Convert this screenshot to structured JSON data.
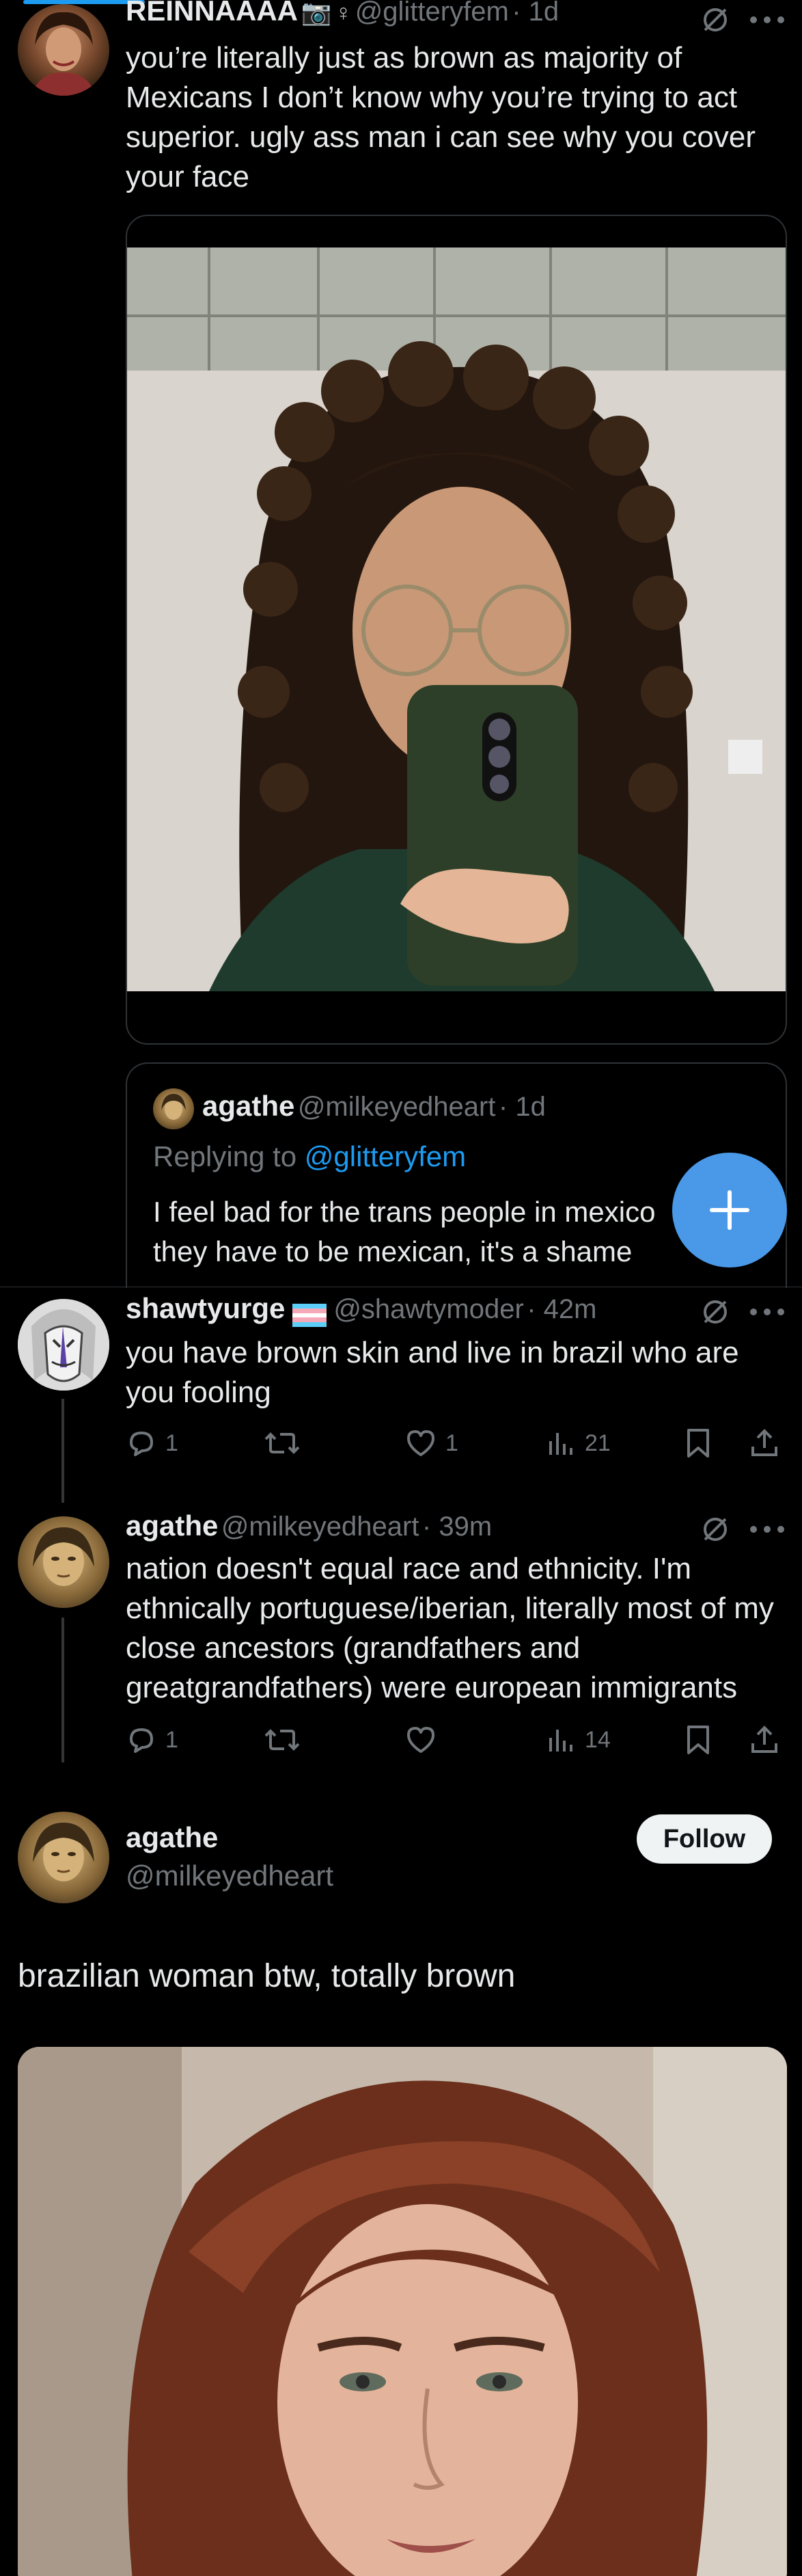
{
  "top_tweet": {
    "name": "REINNAAAA",
    "handle": "@glitteryfem",
    "time": "· 1d",
    "text": "you’re literally just as brown as majority of Mexicans I don’t know why you’re trying to act superior. ugly ass man i can see why you cover your face",
    "quoted": {
      "name": "agathe",
      "handle": "@milkeyedheart",
      "time": "· 1d",
      "replying_prefix": "Replying to",
      "replying_to": "@glitteryfem",
      "text": "I feel bad for the trans people in mexico they have to be mexican, it's a shame"
    }
  },
  "reply_1": {
    "name": "shawtyurge",
    "handle": "@shawtymoder",
    "time": "· 42m",
    "text": "you have brown skin and live in brazil who are you fooling",
    "replies": "1",
    "reposts": "",
    "likes": "1",
    "views": "21"
  },
  "reply_2": {
    "name": "agathe",
    "handle": "@milkeyedheart",
    "time": "· 39m",
    "text": "nation doesn't equal race and ethnicity. I'm ethnically portuguese/iberian, literally most of my close ancestors (grandfathers and greatgrandfathers) were european immigrants",
    "replies": "1",
    "reposts": "",
    "likes": "",
    "views": "14"
  },
  "main_tweet": {
    "name": "agathe",
    "handle": "@milkeyedheart",
    "follow_label": "Follow",
    "text": "brazilian woman btw, totally brown"
  },
  "colors": {
    "background": "#000000",
    "accent": "#1d9bf0",
    "fab": "#4a99e9",
    "text": "#e7e9ea",
    "muted": "#71767b"
  }
}
